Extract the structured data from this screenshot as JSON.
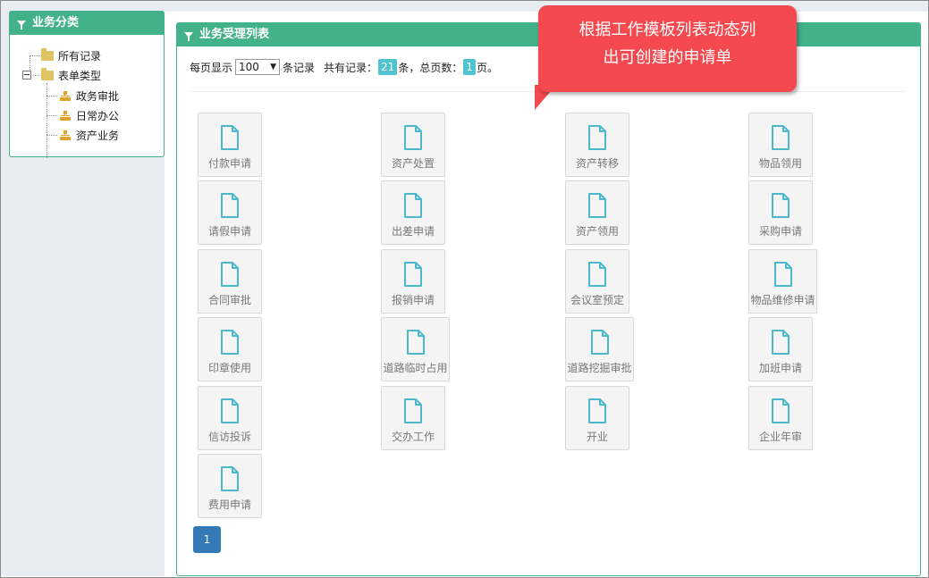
{
  "category_panel": {
    "title": "业务分类",
    "tree": {
      "all_records": "所有记录",
      "form_types": "表单类型",
      "children": [
        "政务审批",
        "日常办公",
        "资产业务"
      ]
    }
  },
  "main_panel": {
    "title": "业务受理列表",
    "page_size_label": "每页显示",
    "page_size_value": "100",
    "records_suffix": "条记录",
    "total_label": "共有记录：",
    "total_count": "21",
    "total_suffix": "条，总页数：",
    "total_pages": "1",
    "pages_suffix": "页。",
    "tiles": [
      "付款申请",
      "资产处置",
      "资产转移",
      "物品领用",
      "请假申请",
      "出差申请",
      "资产领用",
      "采购申请",
      "合同审批",
      "报销申请",
      "会议室预定",
      "物品维修申请",
      "印章使用",
      "道路临时占用",
      "道路挖掘审批",
      "加班申请",
      "信访投诉",
      "交办工作",
      "开业",
      "企业年审",
      "费用申请"
    ],
    "pager": {
      "current": "1"
    }
  },
  "callout": {
    "line1": "根据工作模板列表动态列",
    "line2": "出可创建的申请单"
  },
  "colors": {
    "accent": "#43b18a",
    "badge": "#4fc3d0",
    "pager": "#337ab7",
    "callout": "#f44a4f",
    "doc_icon": "#4bb9cb",
    "folder": "#e0c463"
  },
  "icons": {
    "panel_head": "funnel-icon",
    "tree_folder": "folder-icon",
    "tree_leaf": "org-chart-icon",
    "tile": "document-icon"
  }
}
